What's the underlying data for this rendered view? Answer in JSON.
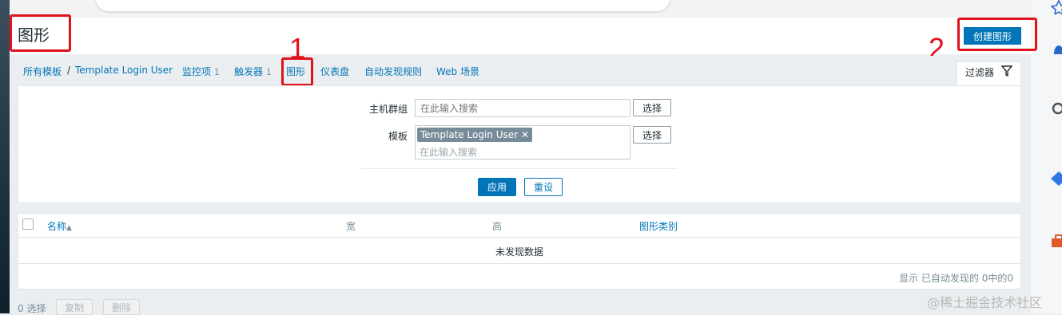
{
  "page": {
    "title": "图形",
    "create_button": "创建图形"
  },
  "annotations": {
    "step1": "1",
    "step2": "2"
  },
  "breadcrumb": {
    "all_templates": "所有模板",
    "separator": "/",
    "template_name": "Template Login User",
    "items": [
      {
        "label": "监控项",
        "count": "1"
      },
      {
        "label": "触发器",
        "count": "1"
      },
      {
        "label": "图形",
        "count": ""
      },
      {
        "label": "仪表盘",
        "count": ""
      },
      {
        "label": "自动发现规则",
        "count": ""
      },
      {
        "label": "Web 场景",
        "count": ""
      }
    ]
  },
  "filter": {
    "tab_label": "过滤器",
    "host_group_label": "主机群组",
    "host_group_placeholder": "在此输入搜索",
    "template_label": "模板",
    "template_tag": "Template Login User",
    "template_placeholder": "在此输入搜索",
    "select_label": "选择",
    "apply_label": "应用",
    "reset_label": "重设"
  },
  "table": {
    "columns": [
      "名称",
      "宽",
      "高",
      "图形类别"
    ],
    "sort_indicator": "▲",
    "empty_text": "未发现数据",
    "summary": "显示 已自动发现的 0中的0"
  },
  "footer": {
    "selected": "0 选择",
    "copy_label": "复制",
    "delete_label": "删除"
  },
  "watermark": "@稀土掘金技术社区",
  "colors": {
    "link": "#0275b8",
    "annotation_red": "#e0121c",
    "tag_bg": "#768d99"
  }
}
